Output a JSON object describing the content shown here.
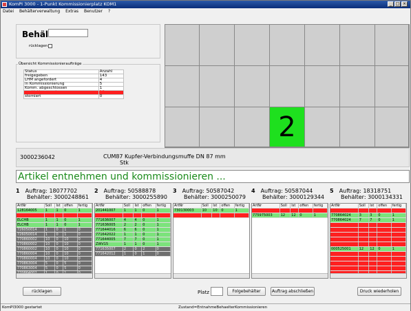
{
  "window": {
    "title": "KomPI 3000 - 1-Punkt Kommissionierplatz KOM1"
  },
  "menu": [
    "Datei",
    "Behälterverwaltung",
    "Extras",
    "Benutzer",
    "?"
  ],
  "behaelter": {
    "label": "Behälter",
    "value": "",
    "ruecklagen_label": "rücklagen"
  },
  "uebersicht": {
    "title": "Übersicht Kommissionieraufträge",
    "headers": [
      "Status",
      "Anzahl"
    ],
    "rows": [
      {
        "status": "freigegeben",
        "anzahl": "143",
        "hl": false
      },
      {
        "status": "LHM angefordert",
        "anzahl": "4",
        "hl": false
      },
      {
        "status": "in Kommissionierung",
        "anzahl": "5",
        "hl": false
      },
      {
        "status": "Komm. abgeschlossen",
        "anzahl": "1",
        "hl": false
      },
      {
        "status": "gestört/ gesperrt",
        "anzahl": "10",
        "hl": true
      },
      {
        "status": "storniert",
        "anzahl": "0",
        "hl": false
      }
    ]
  },
  "big_number": "2",
  "article": {
    "nr": "3000236042",
    "code": "CUM87",
    "desc": "Kupfer-Verbindungsmuffe DN 87 mm",
    "unit": "Stk"
  },
  "instruction": "Artikel entnehmen und kommissionieren ...",
  "colors": {
    "green": "#1ee01e",
    "red": "#ff2020",
    "darkgray": "#6e6e6e",
    "lightgreen": "#7be37b",
    "instruction": "#1a8a1a"
  },
  "orders": [
    {
      "num": "1",
      "auftrag_label": "Auftrag:",
      "auftrag": "18077702",
      "beh_label": "Behälter:",
      "behaelter": "3000248861",
      "headers": [
        "ArtNr",
        "Soll",
        "Ist",
        "offen",
        "fertig"
      ],
      "rows": [
        {
          "c": [
            "128164005",
            "1",
            "1",
            "0",
            "1"
          ],
          "s": "g"
        },
        {
          "c": [
            "...",
            "1",
            "1",
            "0",
            "1"
          ],
          "s": "r"
        },
        {
          "c": [
            "ELCHB",
            "1",
            "1",
            "0",
            "1"
          ],
          "s": "g"
        },
        {
          "c": [
            "ELCHB",
            "1",
            "1",
            "0",
            "1"
          ],
          "s": "g"
        },
        {
          "c": [
            "726050014",
            "1",
            "0",
            "1",
            "0"
          ],
          "s": "d"
        },
        {
          "c": [
            "726050014",
            "1",
            "0",
            "1",
            "0"
          ],
          "s": "d"
        },
        {
          "c": [
            "770860002",
            "10",
            "0",
            "10",
            "0"
          ],
          "s": "d"
        },
        {
          "c": [
            "770860002",
            "10",
            "0",
            "10",
            "0"
          ],
          "s": "d"
        },
        {
          "c": [
            "770860002",
            "10",
            "0",
            "10",
            "0"
          ],
          "s": "d"
        },
        {
          "c": [
            "770860004",
            "10",
            "0",
            "10",
            "0"
          ],
          "s": "d"
        },
        {
          "c": [
            "770860004",
            "10",
            "0",
            "10",
            "0"
          ],
          "s": "d"
        },
        {
          "c": [
            "770863004",
            "5",
            "0",
            "5",
            "0"
          ],
          "s": "d"
        },
        {
          "c": [
            "770863004",
            "5",
            "0",
            "5",
            "0"
          ],
          "s": "d"
        },
        {
          "c": [
            "770864002",
            "1",
            "0",
            "1",
            "0"
          ],
          "s": "d"
        },
        {
          "c": [
            "770864002",
            "1",
            "0",
            "1",
            "0"
          ],
          "s": "d"
        }
      ]
    },
    {
      "num": "2",
      "auftrag_label": "Auftrag:",
      "auftrag": "50588878",
      "beh_label": "Behälter:",
      "behaelter": "3000255890",
      "headers": [
        "ArtNr",
        "Soll",
        "Ist",
        "offen",
        "fertig"
      ],
      "rows": [
        {
          "c": [
            "201441007",
            "1",
            "1",
            "0",
            "1"
          ],
          "s": "g"
        },
        {
          "c": [
            "...",
            "1",
            "1",
            "0",
            "1"
          ],
          "s": "r"
        },
        {
          "c": [
            "771636007",
            "4",
            "4",
            "0",
            "1"
          ],
          "s": "g"
        },
        {
          "c": [
            "771636005",
            "2",
            "2",
            "0",
            "1"
          ],
          "s": "g"
        },
        {
          "c": [
            "771644016",
            "6",
            "6",
            "0",
            "1"
          ],
          "s": "g"
        },
        {
          "c": [
            "771642022",
            "1",
            "1",
            "0",
            "1"
          ],
          "s": "g"
        },
        {
          "c": [
            "771644005",
            "7",
            "7",
            "0",
            "1"
          ],
          "s": "g"
        },
        {
          "c": [
            "ZWV15",
            "1",
            "1",
            "0",
            "1"
          ],
          "s": "g"
        },
        {
          "c": [
            "771635007",
            "2",
            "0",
            "2",
            "0"
          ],
          "s": "d"
        },
        {
          "c": [
            "771642012",
            "1",
            "0",
            "1",
            "0"
          ],
          "s": "d"
        }
      ]
    },
    {
      "num": "3",
      "auftrag_label": "Auftrag:",
      "auftrag": "50587042",
      "beh_label": "Behälter:",
      "behaelter": "3000250079",
      "headers": [
        "ArtNr",
        "Soll",
        "Ist",
        "offen",
        "fertig"
      ],
      "rows": [
        {
          "c": [
            "730130003",
            "10",
            "10",
            "0",
            "1"
          ],
          "s": "g"
        },
        {
          "c": [
            "...",
            "",
            "",
            "",
            "1"
          ],
          "s": "r"
        }
      ]
    },
    {
      "num": "4",
      "auftrag_label": "Auftrag:",
      "auftrag": "50587044",
      "beh_label": "Behälter:",
      "behaelter": "3000129344",
      "headers": [
        "ArtNr",
        "Soll",
        "Ist",
        "offen",
        "fertig"
      ],
      "rows": [
        {
          "c": [
            "...",
            "",
            "",
            "",
            "1"
          ],
          "s": "r"
        },
        {
          "c": [
            "775975003",
            "12",
            "12",
            "0",
            "1"
          ],
          "s": "g"
        }
      ]
    },
    {
      "num": "5",
      "auftrag_label": "Auftrag:",
      "auftrag": "18318751",
      "beh_label": "Behälter:",
      "behaelter": "3000134331",
      "headers": [
        "ArtNr",
        "Soll",
        "Ist",
        "offen",
        "fertig"
      ],
      "rows": [
        {
          "c": [
            "...",
            "",
            "",
            "",
            ""
          ],
          "s": "r"
        },
        {
          "c": [
            "770864024",
            "3",
            "3",
            "0",
            "1"
          ],
          "s": "g"
        },
        {
          "c": [
            "770864024",
            "7",
            "7",
            "0",
            "1"
          ],
          "s": "g"
        },
        {
          "c": [
            "...",
            "",
            "",
            "",
            ""
          ],
          "s": "r"
        },
        {
          "c": [
            "...",
            "",
            "",
            "",
            ""
          ],
          "s": "r"
        },
        {
          "c": [
            "...",
            "",
            "",
            "",
            ""
          ],
          "s": "r"
        },
        {
          "c": [
            "...",
            "",
            "",
            "",
            ""
          ],
          "s": "r"
        },
        {
          "c": [
            "...",
            "",
            "",
            "",
            ""
          ],
          "s": "r"
        },
        {
          "c": [
            "000525001",
            "12",
            "12",
            "0",
            "1"
          ],
          "s": "g"
        },
        {
          "c": [
            "...",
            "",
            "",
            "",
            ""
          ],
          "s": "r"
        },
        {
          "c": [
            "...",
            "",
            "",
            "",
            ""
          ],
          "s": "r"
        },
        {
          "c": [
            "...",
            "",
            "",
            "",
            ""
          ],
          "s": "r"
        },
        {
          "c": [
            "...",
            "",
            "",
            "",
            ""
          ],
          "s": "r"
        },
        {
          "c": [
            "...",
            "",
            "",
            "",
            ""
          ],
          "s": "r"
        },
        {
          "c": [
            "CUM87",
            "",
            "",
            "",
            ""
          ],
          "s": "r"
        }
      ]
    }
  ],
  "buttons": {
    "ruecklagen": "rücklagen",
    "folgebehaelter": "Folgebehälter",
    "auftrag_abschliessen": "Auftrag abschließen",
    "druck": "Druck wiederholen"
  },
  "platz": {
    "label": "Platz",
    "value": ""
  },
  "statusbar": {
    "left": "KomPI3000 gestartet",
    "right": "Zustand=EntnahmeBehaelterKommissionieren"
  }
}
